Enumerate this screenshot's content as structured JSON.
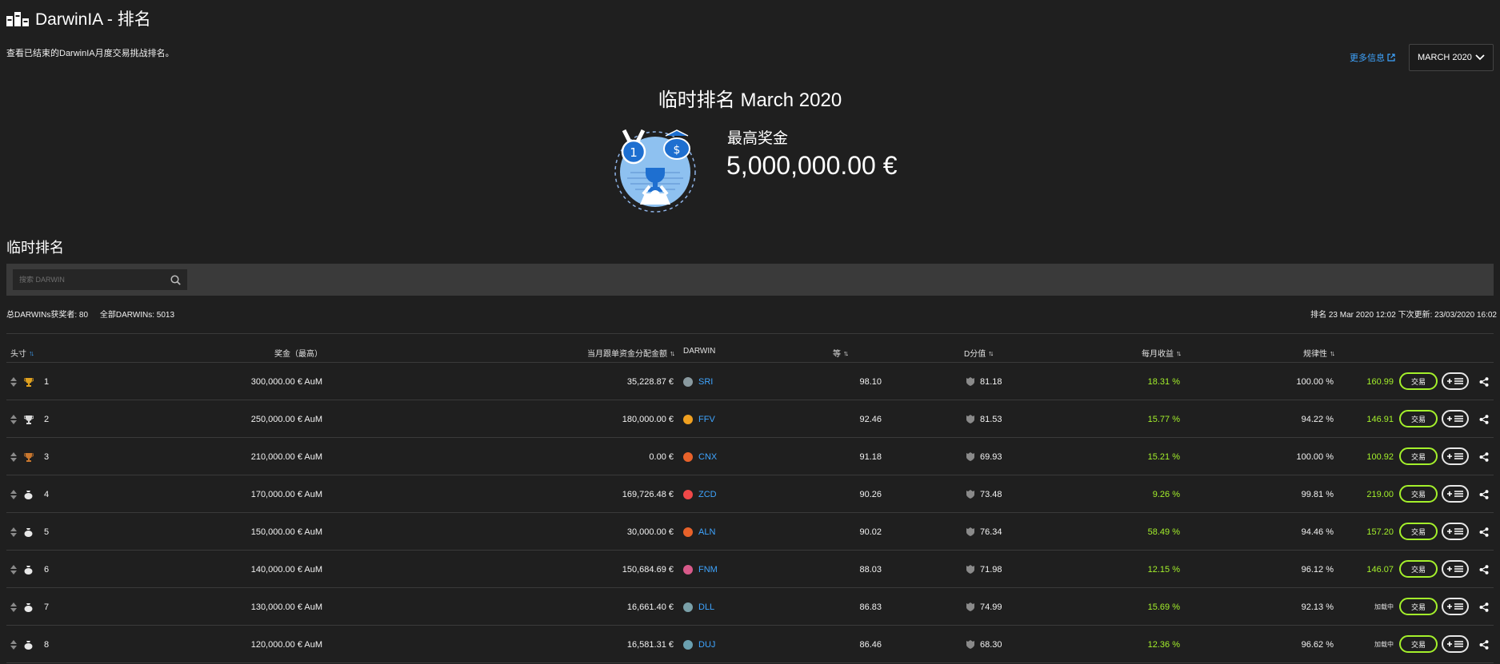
{
  "app": {
    "title": "DarwinIA - 排名"
  },
  "subtitle": "查看已结束的DarwinIA月度交易挑战排名。",
  "header": {
    "more_info": "更多信息",
    "month_value": "MARCH 2020"
  },
  "hero": {
    "title": "临时排名 March 2020",
    "prize_label": "最高奖金",
    "prize_amount": "5,000,000.00 €"
  },
  "section_title": "临时排名",
  "search": {
    "placeholder": "搜索 DARWIN"
  },
  "stats": {
    "winners": "总DARWINs获奖者: 80",
    "total": "全部DARWINs: 5013",
    "updated": "排名 23 Mar 2020 12:02 下次更新: 23/03/2020 16:02"
  },
  "columns": {
    "rank": "头寸",
    "prize": "奖金（最高）",
    "allocation": "当月跟单资金分配金额",
    "darwin": "DARWIN",
    "grade": "等",
    "dscore": "D分值",
    "monthly": "每月收益",
    "discipline": "规律性"
  },
  "colors": {
    "accent": "#3fa5ff",
    "positive": "#a4f02b",
    "gold": "#e0a11f",
    "silver": "#d9d9d9",
    "bronze": "#c9772e"
  },
  "rows": [
    {
      "rank": "1",
      "trophy": "trophy-gold",
      "prize": "300,000.00 € AuM",
      "allocation": "35,228.87 €",
      "darwin": "SRI",
      "dot_color": "#8a9aa0",
      "grade": "98.10",
      "dscore": "81.18",
      "monthly": "18.31 %",
      "discipline": "100.00 %",
      "price": "160.99",
      "trade": "交易"
    },
    {
      "rank": "2",
      "trophy": "trophy-silver",
      "prize": "250,000.00 € AuM",
      "allocation": "180,000.00 €",
      "darwin": "FFV",
      "dot_color": "#f0a020",
      "grade": "92.46",
      "dscore": "81.53",
      "monthly": "15.77 %",
      "discipline": "94.22 %",
      "price": "146.91",
      "trade": "交易"
    },
    {
      "rank": "3",
      "trophy": "trophy-bronze",
      "prize": "210,000.00 € AuM",
      "allocation": "0.00 €",
      "darwin": "CNX",
      "dot_color": "#e8622a",
      "grade": "91.18",
      "dscore": "69.93",
      "monthly": "15.21 %",
      "discipline": "100.00 %",
      "price": "100.92",
      "trade": "交易"
    },
    {
      "rank": "4",
      "trophy": "moneybag",
      "prize": "170,000.00 € AuM",
      "allocation": "169,726.48 €",
      "darwin": "ZCD",
      "dot_color": "#f04848",
      "grade": "90.26",
      "dscore": "73.48",
      "monthly": "9.26 %",
      "discipline": "99.81 %",
      "price": "219.00",
      "trade": "交易"
    },
    {
      "rank": "5",
      "trophy": "moneybag",
      "prize": "150,000.00 € AuM",
      "allocation": "30,000.00 €",
      "darwin": "ALN",
      "dot_color": "#e8622a",
      "grade": "90.02",
      "dscore": "76.34",
      "monthly": "58.49 %",
      "discipline": "94.46 %",
      "price": "157.20",
      "trade": "交易"
    },
    {
      "rank": "6",
      "trophy": "moneybag",
      "prize": "140,000.00 € AuM",
      "allocation": "150,684.69 €",
      "darwin": "FNM",
      "dot_color": "#d85a8a",
      "grade": "88.03",
      "dscore": "71.98",
      "monthly": "12.15 %",
      "discipline": "96.12 %",
      "price": "146.07",
      "trade": "交易"
    },
    {
      "rank": "7",
      "trophy": "moneybag",
      "prize": "130,000.00 € AuM",
      "allocation": "16,661.40 €",
      "darwin": "DLL",
      "dot_color": "#7aa0a8",
      "grade": "86.83",
      "dscore": "74.99",
      "monthly": "15.69 %",
      "discipline": "92.13 %",
      "price": "加载中",
      "price_pending": true,
      "trade": "交易"
    },
    {
      "rank": "8",
      "trophy": "moneybag",
      "prize": "120,000.00 € AuM",
      "allocation": "16,581.31 €",
      "darwin": "DUJ",
      "dot_color": "#6aa0b0",
      "grade": "86.46",
      "dscore": "68.30",
      "monthly": "12.36 %",
      "discipline": "96.62 %",
      "price": "加载中",
      "price_pending": true,
      "trade": "交易"
    }
  ]
}
